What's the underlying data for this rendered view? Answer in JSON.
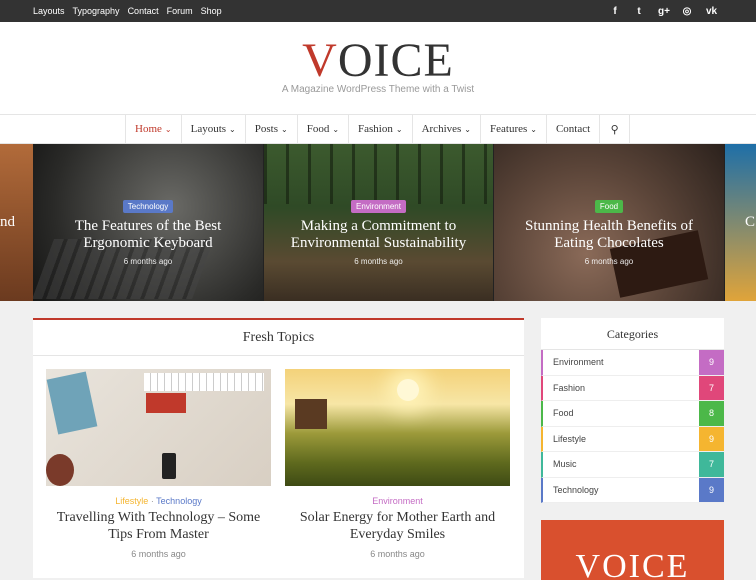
{
  "topbar": {
    "links": [
      "Layouts",
      "Typography",
      "Contact",
      "Forum",
      "Shop"
    ],
    "social_icons": [
      "facebook-icon",
      "twitter-icon",
      "google-plus-icon",
      "instagram-icon",
      "vk-icon"
    ],
    "social_glyphs": [
      "f",
      "t",
      "g+",
      "◎",
      "vk"
    ]
  },
  "header": {
    "logo_first": "V",
    "logo_rest": "OICE",
    "tagline": "A Magazine WordPress Theme with a Twist"
  },
  "nav": {
    "items": [
      "Home",
      "Layouts",
      "Posts",
      "Food",
      "Fashion",
      "Archives",
      "Features",
      "Contact"
    ],
    "search_glyph": "⚲"
  },
  "slider": {
    "left_edge_text": "nd",
    "right_edge_text": "C",
    "slides": [
      {
        "category": "Technology",
        "title": "The Features of the Best Ergonomic Keyboard",
        "time": "6 months ago"
      },
      {
        "category": "Environment",
        "title": "Making a Commitment to Environmental Sustainability",
        "time": "6 months ago"
      },
      {
        "category": "Food",
        "title": "Stunning Health Benefits of Eating Chocolates",
        "time": "6 months ago"
      }
    ]
  },
  "fresh_topics": {
    "title": "Fresh Topics",
    "posts": [
      {
        "cat1": "Lifestyle",
        "sep": "·",
        "cat2": "Technology",
        "title": "Travelling With Technology – Some Tips From Master",
        "time": "6 months ago"
      },
      {
        "cat1": "Environment",
        "title": "Solar Energy for Mother Earth and Everyday Smiles",
        "time": "6 months ago"
      }
    ]
  },
  "categories": {
    "title": "Categories",
    "items": [
      {
        "name": "Environment",
        "count": "9",
        "color": "#c46cc4"
      },
      {
        "name": "Fashion",
        "count": "7",
        "color": "#e0477a"
      },
      {
        "name": "Food",
        "count": "8",
        "color": "#4cb849"
      },
      {
        "name": "Lifestyle",
        "count": "9",
        "color": "#f5b530"
      },
      {
        "name": "Music",
        "count": "7",
        "color": "#3fb89a"
      },
      {
        "name": "Technology",
        "count": "9",
        "color": "#5a79c8"
      }
    ]
  },
  "promo": {
    "text": "VOICE"
  },
  "colors": {
    "accent": "#c0392b",
    "environment": "#c46cc4",
    "technology": "#5a79c8",
    "food": "#4cb849",
    "lifestyle": "#f5b530"
  }
}
